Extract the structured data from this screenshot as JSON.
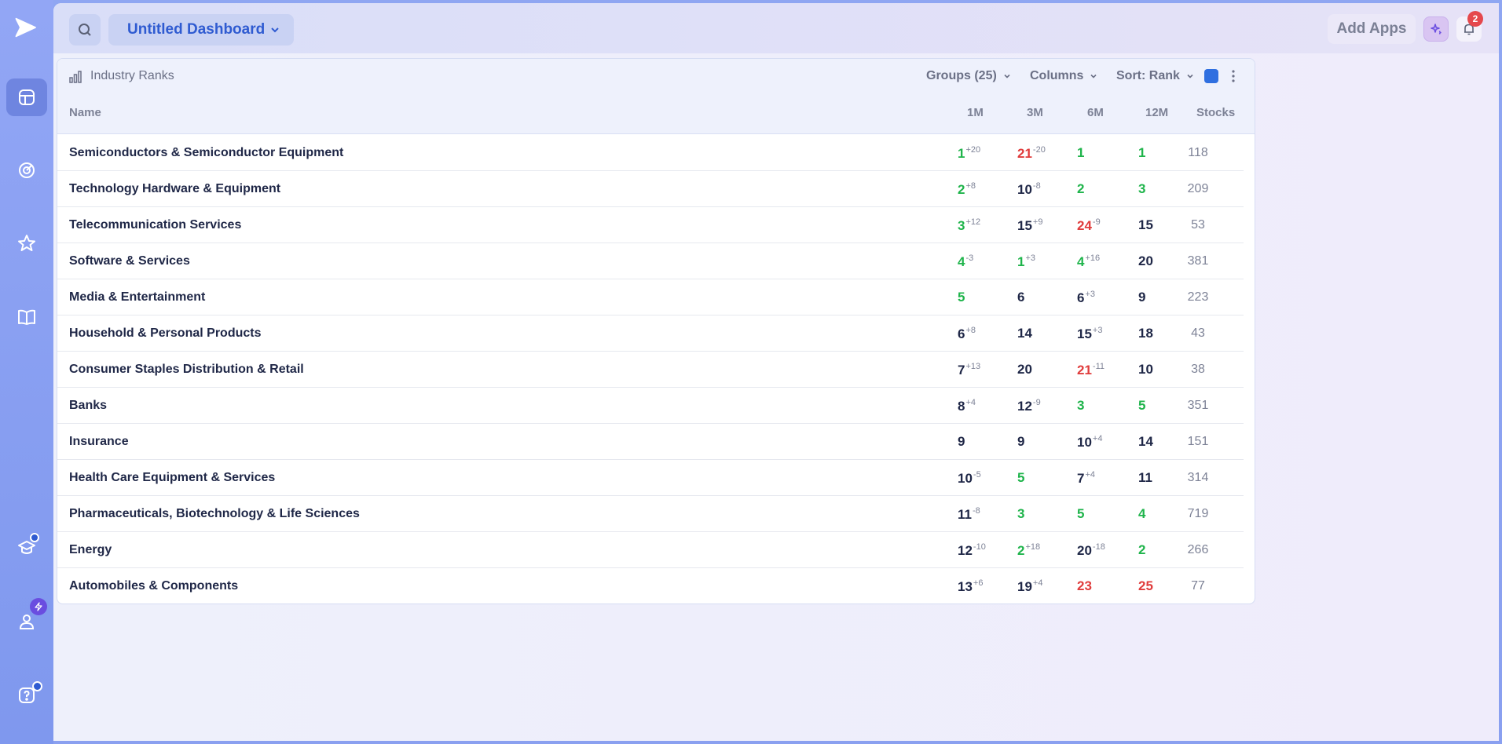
{
  "topbar": {
    "dashboard_title": "Untitled Dashboard",
    "add_apps_label": "Add Apps",
    "notification_count": "2"
  },
  "panel": {
    "title": "Industry Ranks",
    "groups_label": "Groups (25)",
    "columns_label": "Columns",
    "sort_label": "Sort: Rank",
    "swatch_color": "#2f6fe0"
  },
  "table": {
    "headers": [
      "Name",
      "1M",
      "3M",
      "6M",
      "12M",
      "Stocks"
    ],
    "rows": [
      {
        "name": "Semiconductors & Semiconductor Equipment",
        "m1": {
          "v": "1",
          "d": "+20",
          "c": "green"
        },
        "m3": {
          "v": "21",
          "d": "-20",
          "c": "red"
        },
        "m6": {
          "v": "1",
          "d": "",
          "c": "green"
        },
        "m12": {
          "v": "1",
          "d": "",
          "c": "green"
        },
        "stocks": "118"
      },
      {
        "name": "Technology Hardware & Equipment",
        "m1": {
          "v": "2",
          "d": "+8",
          "c": "green"
        },
        "m3": {
          "v": "10",
          "d": "-8",
          "c": ""
        },
        "m6": {
          "v": "2",
          "d": "",
          "c": "green"
        },
        "m12": {
          "v": "3",
          "d": "",
          "c": "green"
        },
        "stocks": "209"
      },
      {
        "name": "Telecommunication Services",
        "m1": {
          "v": "3",
          "d": "+12",
          "c": "green"
        },
        "m3": {
          "v": "15",
          "d": "+9",
          "c": ""
        },
        "m6": {
          "v": "24",
          "d": "-9",
          "c": "red"
        },
        "m12": {
          "v": "15",
          "d": "",
          "c": ""
        },
        "stocks": "53"
      },
      {
        "name": "Software & Services",
        "m1": {
          "v": "4",
          "d": "-3",
          "c": "green"
        },
        "m3": {
          "v": "1",
          "d": "+3",
          "c": "green"
        },
        "m6": {
          "v": "4",
          "d": "+16",
          "c": "green"
        },
        "m12": {
          "v": "20",
          "d": "",
          "c": ""
        },
        "stocks": "381"
      },
      {
        "name": "Media & Entertainment",
        "m1": {
          "v": "5",
          "d": "",
          "c": "green"
        },
        "m3": {
          "v": "6",
          "d": "",
          "c": ""
        },
        "m6": {
          "v": "6",
          "d": "+3",
          "c": ""
        },
        "m12": {
          "v": "9",
          "d": "",
          "c": ""
        },
        "stocks": "223"
      },
      {
        "name": "Household & Personal Products",
        "m1": {
          "v": "6",
          "d": "+8",
          "c": ""
        },
        "m3": {
          "v": "14",
          "d": "",
          "c": ""
        },
        "m6": {
          "v": "15",
          "d": "+3",
          "c": ""
        },
        "m12": {
          "v": "18",
          "d": "",
          "c": ""
        },
        "stocks": "43"
      },
      {
        "name": "Consumer Staples Distribution & Retail",
        "m1": {
          "v": "7",
          "d": "+13",
          "c": ""
        },
        "m3": {
          "v": "20",
          "d": "",
          "c": ""
        },
        "m6": {
          "v": "21",
          "d": "-11",
          "c": "red"
        },
        "m12": {
          "v": "10",
          "d": "",
          "c": ""
        },
        "stocks": "38"
      },
      {
        "name": "Banks",
        "m1": {
          "v": "8",
          "d": "+4",
          "c": ""
        },
        "m3": {
          "v": "12",
          "d": "-9",
          "c": ""
        },
        "m6": {
          "v": "3",
          "d": "",
          "c": "green"
        },
        "m12": {
          "v": "5",
          "d": "",
          "c": "green"
        },
        "stocks": "351"
      },
      {
        "name": "Insurance",
        "m1": {
          "v": "9",
          "d": "",
          "c": ""
        },
        "m3": {
          "v": "9",
          "d": "",
          "c": ""
        },
        "m6": {
          "v": "10",
          "d": "+4",
          "c": ""
        },
        "m12": {
          "v": "14",
          "d": "",
          "c": ""
        },
        "stocks": "151"
      },
      {
        "name": "Health Care Equipment & Services",
        "m1": {
          "v": "10",
          "d": "-5",
          "c": ""
        },
        "m3": {
          "v": "5",
          "d": "",
          "c": "green"
        },
        "m6": {
          "v": "7",
          "d": "+4",
          "c": ""
        },
        "m12": {
          "v": "11",
          "d": "",
          "c": ""
        },
        "stocks": "314"
      },
      {
        "name": "Pharmaceuticals, Biotechnology & Life Sciences",
        "m1": {
          "v": "11",
          "d": "-8",
          "c": ""
        },
        "m3": {
          "v": "3",
          "d": "",
          "c": "green"
        },
        "m6": {
          "v": "5",
          "d": "",
          "c": "green"
        },
        "m12": {
          "v": "4",
          "d": "",
          "c": "green"
        },
        "stocks": "719"
      },
      {
        "name": "Energy",
        "m1": {
          "v": "12",
          "d": "-10",
          "c": ""
        },
        "m3": {
          "v": "2",
          "d": "+18",
          "c": "green"
        },
        "m6": {
          "v": "20",
          "d": "-18",
          "c": ""
        },
        "m12": {
          "v": "2",
          "d": "",
          "c": "green"
        },
        "stocks": "266"
      },
      {
        "name": "Automobiles & Components",
        "m1": {
          "v": "13",
          "d": "+6",
          "c": ""
        },
        "m3": {
          "v": "19",
          "d": "+4",
          "c": ""
        },
        "m6": {
          "v": "23",
          "d": "",
          "c": "red"
        },
        "m12": {
          "v": "25",
          "d": "",
          "c": "red"
        },
        "stocks": "77"
      }
    ]
  },
  "icons": {
    "sidebar": [
      "logo-icon",
      "dashboard-icon",
      "radar-icon",
      "star-icon",
      "book-icon",
      "learn-icon",
      "profile-icon",
      "help-icon"
    ]
  }
}
